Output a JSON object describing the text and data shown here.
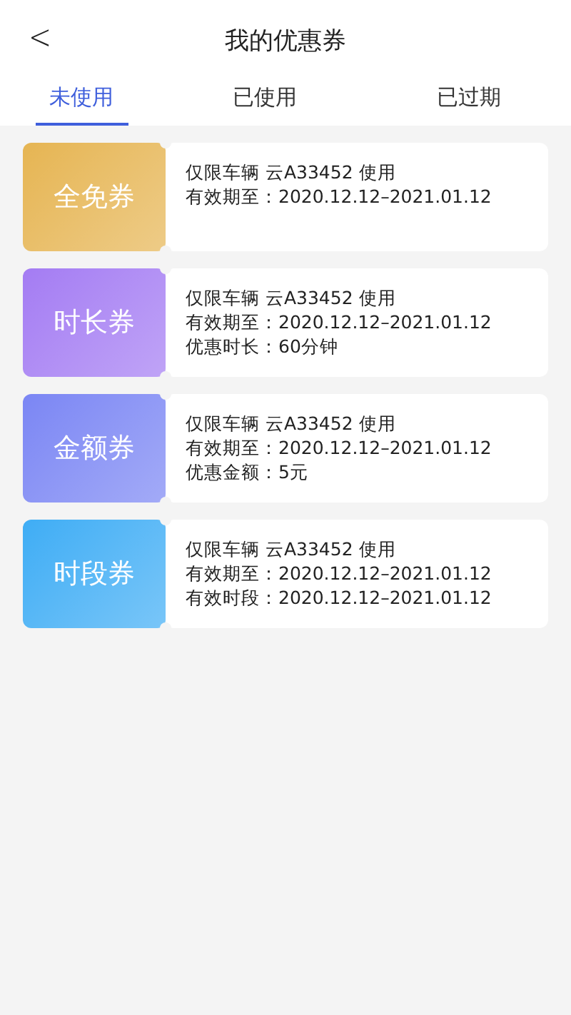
{
  "header": {
    "back": "<",
    "title": "我的优惠券"
  },
  "tabs": [
    {
      "label": "未使用",
      "selected": true
    },
    {
      "label": "已使用",
      "selected": false
    },
    {
      "label": "已过期",
      "selected": false
    }
  ],
  "coupons": [
    {
      "name": "全免券",
      "color": "#e6b553",
      "lines": [
        "仅限车辆 云A33452 使用",
        "有效期至：2020.12.12–2021.01.12"
      ]
    },
    {
      "name": "时长券",
      "color": "#a47cf3",
      "lines": [
        "仅限车辆 云A33452 使用",
        "有效期至：2020.12.12–2021.01.12",
        "优惠时长：60分钟"
      ]
    },
    {
      "name": "金额券",
      "color": "#7b86f4",
      "lines": [
        "仅限车辆 云A33452 使用",
        "有效期至：2020.12.12–2021.01.12",
        "优惠金额：5元"
      ]
    },
    {
      "name": "时段券",
      "color": "#3fadf5",
      "lines": [
        "仅限车辆 云A33452 使用",
        "有效期至：2020.12.12–2021.01.12",
        "有效时段：2020.12.12–2021.01.12"
      ]
    }
  ]
}
